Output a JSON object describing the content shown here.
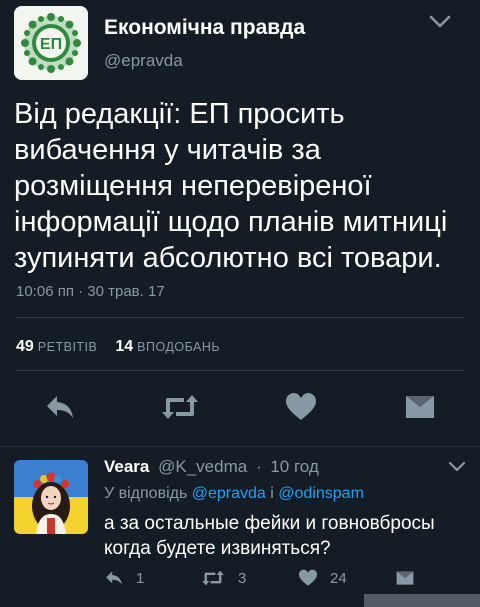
{
  "main_tweet": {
    "display_name": "Економічна правда",
    "handle": "@epravda",
    "text": "Від редакції: ЕП просить вибачення у читачів за розміщення неперевіреної інформації щодо планів митниці зупиняти абсолютно всі товари.",
    "timestamp": "10:06 пп · 30 трав. 17",
    "retweets_count": "49",
    "retweets_label": "РЕТВІТІВ",
    "likes_count": "14",
    "likes_label": "ВПОДОБАНЬ",
    "logo_letters": "ЕП"
  },
  "actions": {
    "reply_icon": "reply-icon",
    "retweet_icon": "retweet-icon",
    "like_icon": "heart-icon",
    "message_icon": "envelope-icon"
  },
  "reply": {
    "display_name": "Veara",
    "handle": "@K_vedma",
    "dot": "·",
    "time": "10 год",
    "reply_prefix": "У відповідь",
    "mention_1": "@epravda",
    "conjunction": "і",
    "mention_2": "@odinspam",
    "text": "а за остальные фейки и говновбросы когда будете извиняться?",
    "reply_count": "1",
    "retweet_count": "3",
    "like_count": "24"
  },
  "colors": {
    "background": "#141d26",
    "secondary_text": "#8899a6",
    "link": "#1da1f2",
    "icon": "#8899a6",
    "logo_green": "#2e8b3e"
  }
}
